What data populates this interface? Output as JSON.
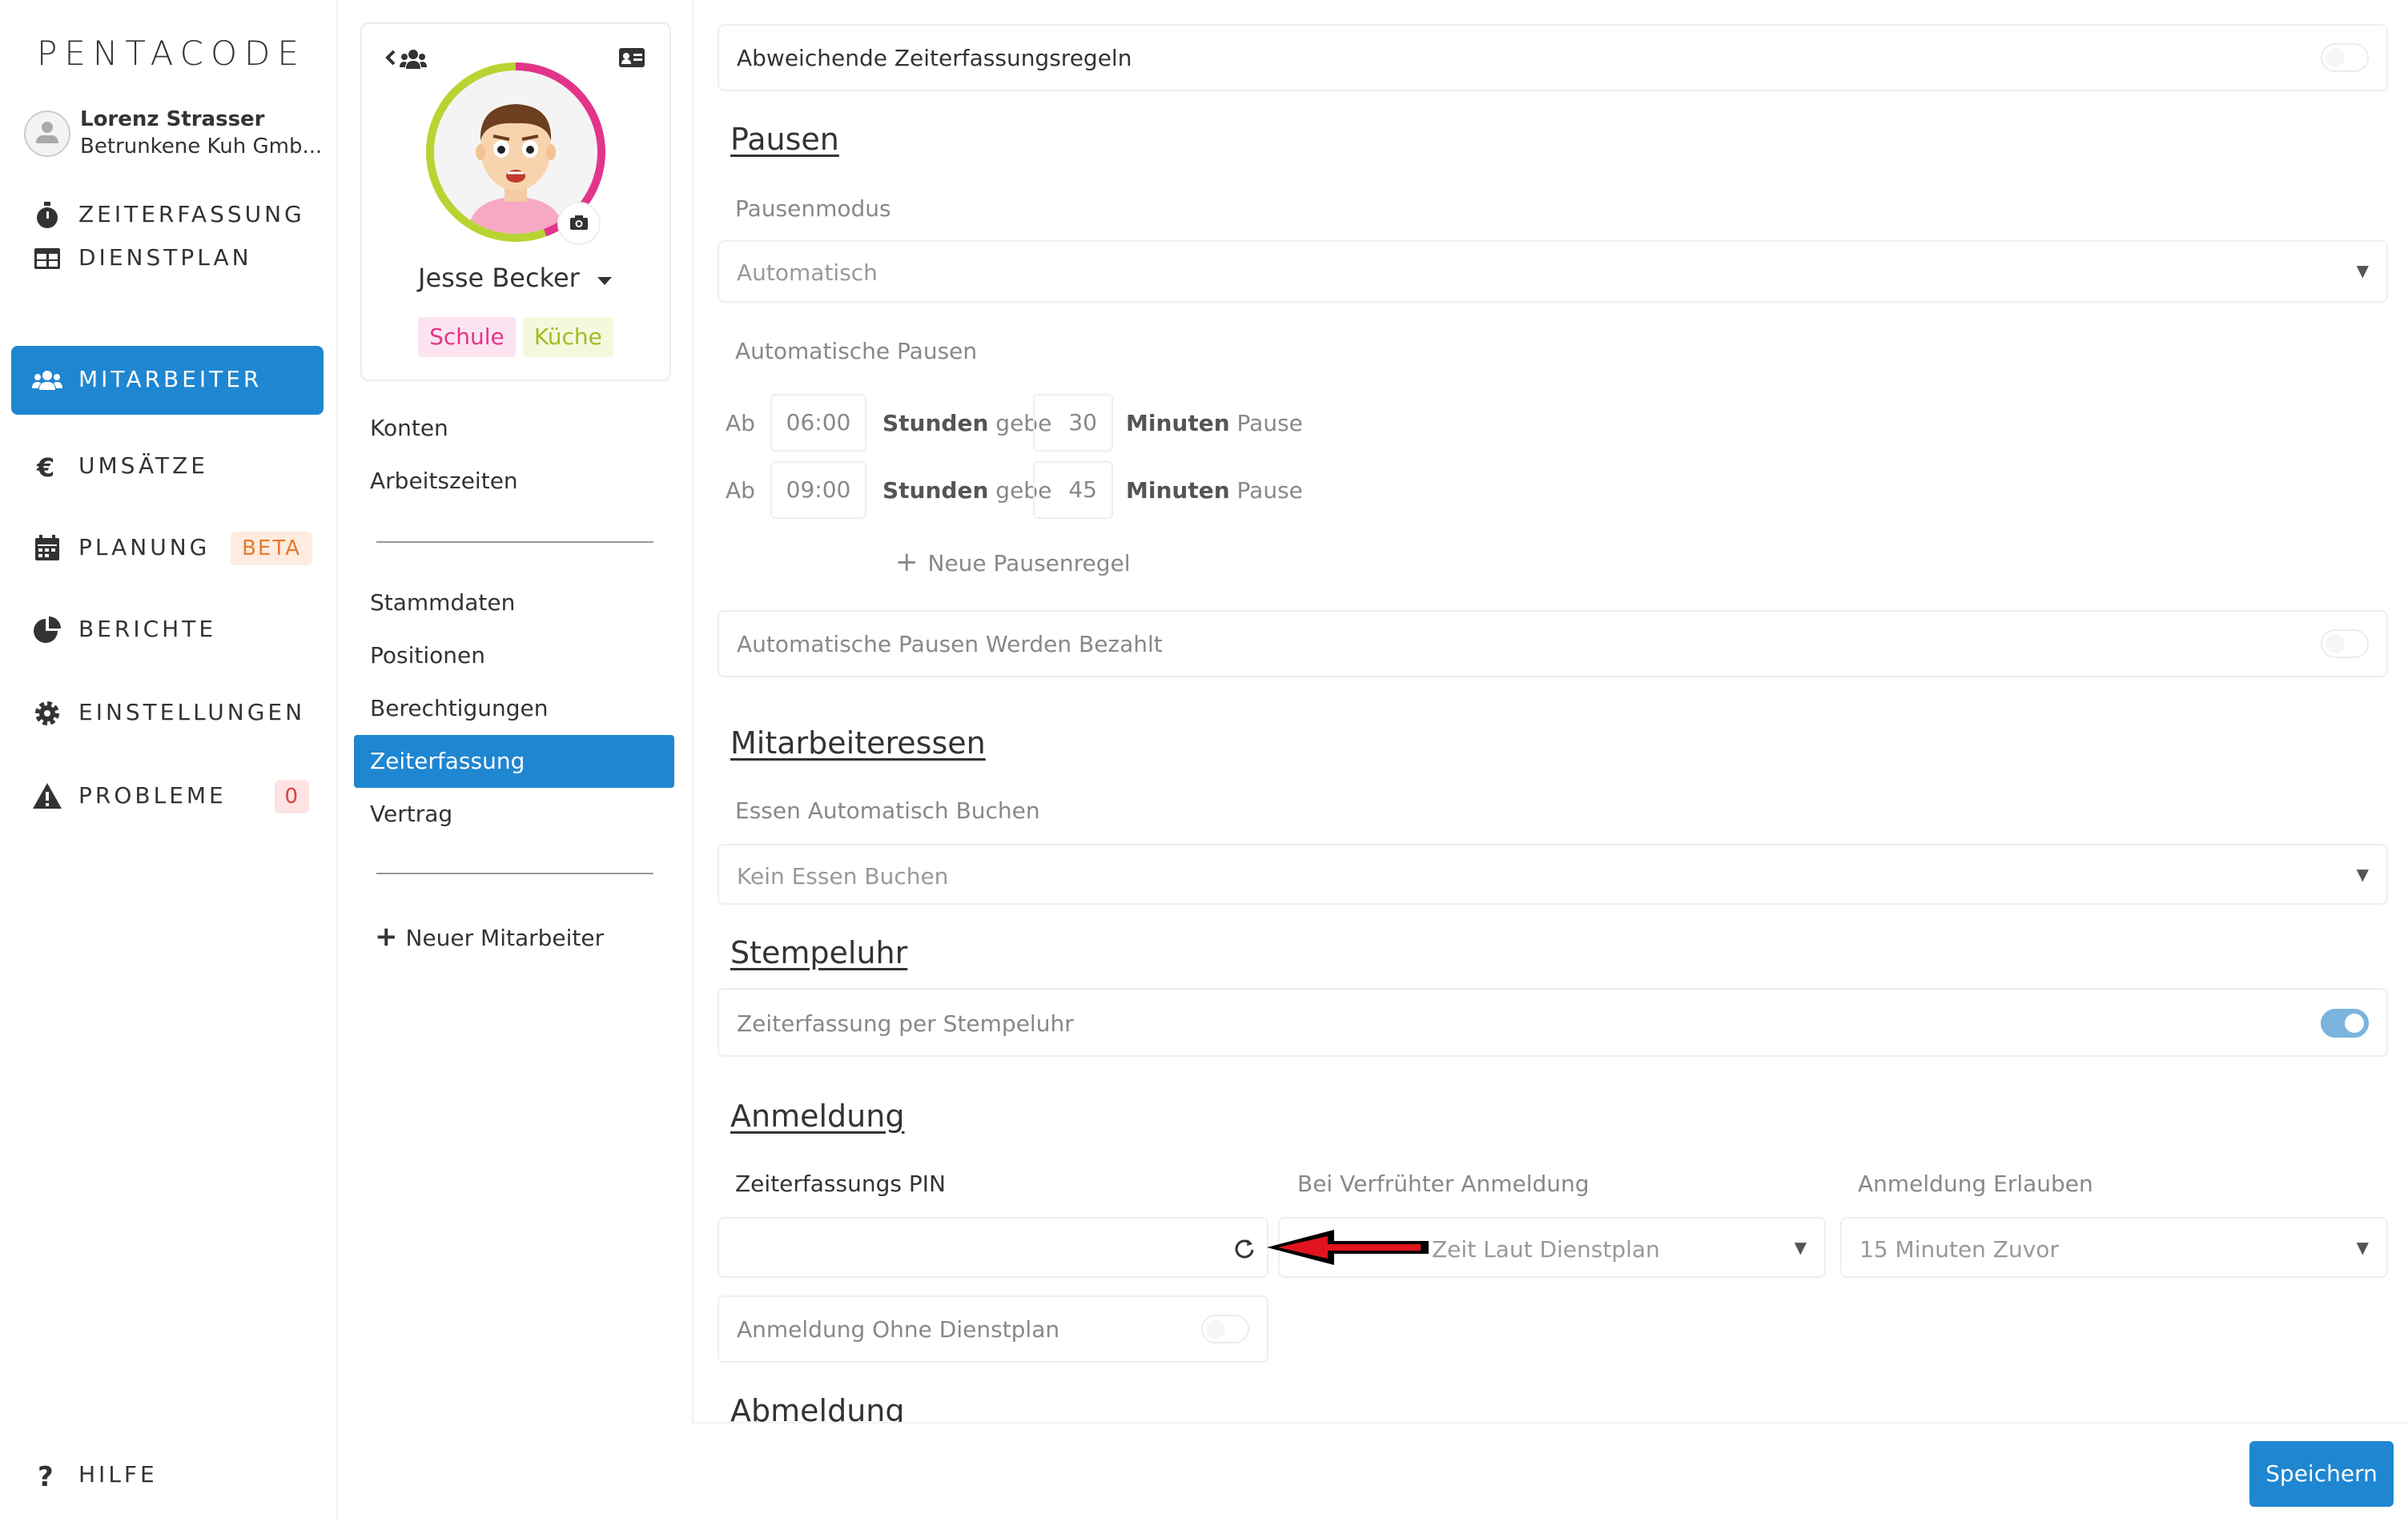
{
  "nav": {
    "logo": "PENTACODE",
    "user": {
      "name": "Lorenz Strasser",
      "company": "Betrunkene Kuh Gmb..."
    },
    "items": [
      {
        "label": "ZEITERFASSUNG"
      },
      {
        "label": "DIENSTPLAN"
      },
      {
        "label": "MITARBEITER"
      },
      {
        "label": "UMSÄTZE"
      },
      {
        "label": "PLANUNG",
        "badge": "BETA"
      },
      {
        "label": "BERICHTE"
      },
      {
        "label": "EINSTELLUNGEN"
      },
      {
        "label": "PROBLEME",
        "badge": "0"
      }
    ],
    "help": "HILFE"
  },
  "profile": {
    "name": "Jesse Becker",
    "tags": [
      "Schule",
      "Küche"
    ],
    "menu_top": [
      "Konten",
      "Arbeitszeiten"
    ],
    "menu_mid": [
      "Stammdaten",
      "Positionen",
      "Berechtigungen",
      "Zeiterfassung",
      "Vertrag"
    ],
    "new_employee": "Neuer Mitarbeiter"
  },
  "main": {
    "deviating_rules": "Abweichende Zeiterfassungsregeln",
    "pauses": {
      "title": "Pausen",
      "mode_label": "Pausenmodus",
      "mode_value": "Automatisch",
      "auto_label": "Automatische Pausen",
      "rule_ab": "Ab",
      "rule_stunden": "Stunden",
      "rule_gebe": "gebe",
      "rule_minuten": "Minuten",
      "rule_pause": "Pause",
      "rules": [
        {
          "hours": "06:00",
          "minutes": "30"
        },
        {
          "hours": "09:00",
          "minutes": "45"
        }
      ],
      "new_rule": "Neue Pausenregel",
      "paid_label": "Automatische Pausen Werden Bezahlt"
    },
    "meals": {
      "title": "Mitarbeiteressen",
      "label": "Essen Automatisch Buchen",
      "value": "Kein Essen Buchen"
    },
    "clock": {
      "title": "Stempeluhr",
      "label": "Zeiterfassung per Stempeluhr"
    },
    "login": {
      "title": "Anmeldung",
      "pin_label": "Zeiterfassungs PIN",
      "pin_value": "",
      "early_label": "Bei Verfrühter Anmeldung",
      "early_value": "Zeit Laut Dienstplan",
      "allow_label": "Anmeldung Erlauben",
      "allow_value": "15 Minuten Zuvor",
      "without_roster": "Anmeldung Ohne Dienstplan"
    },
    "logout": {
      "title": "Abmeldung"
    },
    "save": "Speichern"
  },
  "colors": {
    "accent": "#1f86d1",
    "pink": "#e2358a",
    "lime": "#b7d432",
    "arrow": "#e0141e"
  }
}
